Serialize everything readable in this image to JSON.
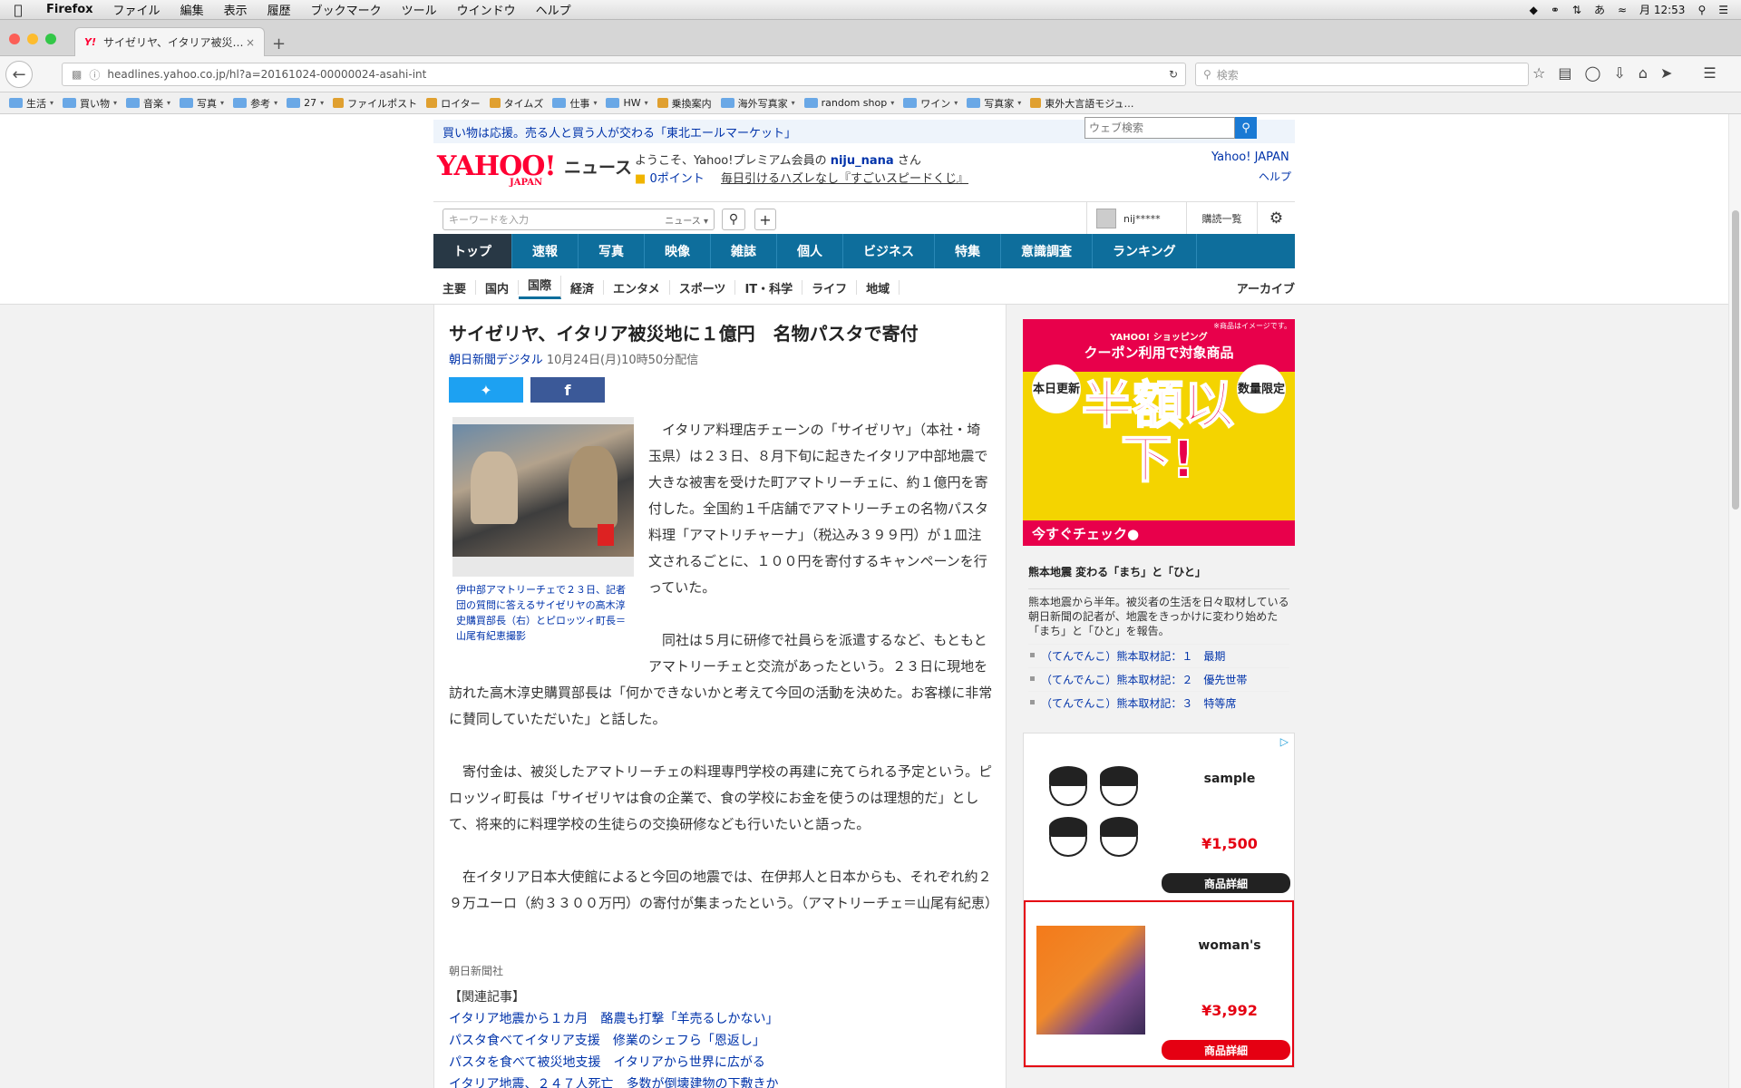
{
  "menubar": {
    "app": "Firefox",
    "items": [
      "ファイル",
      "編集",
      "表示",
      "履歴",
      "ブックマーク",
      "ツール",
      "ウインドウ",
      "ヘルプ"
    ],
    "clock": "月 12:53"
  },
  "tab": {
    "favicon": "Y!",
    "title": "サイゼリヤ、イタリア被災…",
    "close": "×",
    "new_tab": "+"
  },
  "navbar": {
    "url": "headlines.yahoo.co.jp/hl?a=20161024-00000024-asahi-int",
    "search_placeholder": "検索"
  },
  "bookmarks": [
    {
      "label": "生活",
      "folder": true
    },
    {
      "label": "買い物",
      "folder": true
    },
    {
      "label": "音楽",
      "folder": true
    },
    {
      "label": "写真",
      "folder": true
    },
    {
      "label": "参考",
      "folder": true
    },
    {
      "label": "27",
      "folder": true
    },
    {
      "label": "ファイルポスト",
      "folder": false
    },
    {
      "label": "ロイター",
      "folder": false
    },
    {
      "label": "タイムズ",
      "folder": false
    },
    {
      "label": "仕事",
      "folder": true
    },
    {
      "label": "HW",
      "folder": true
    },
    {
      "label": "乗換案内",
      "folder": false
    },
    {
      "label": "海外写真家",
      "folder": true
    },
    {
      "label": "random shop",
      "folder": true
    },
    {
      "label": "ワイン",
      "folder": true
    },
    {
      "label": "写真家",
      "folder": true
    },
    {
      "label": "東外大言語モジュ…",
      "folder": false
    }
  ],
  "header": {
    "promo": "買い物は応援。売る人と買う人が交わる「東北エールマーケット」",
    "web_search_placeholder": "ウェブ検索",
    "logo": "YAHOO!",
    "logo_sub": "JAPAN",
    "logo_news": "ニュース",
    "welcome_prefix": "ようこそ、Yahoo!プレミアム会員の",
    "welcome_user": "niju_nana",
    "welcome_suffix": "さん",
    "points": "0ポイント",
    "kuji": "毎日引けるハズレなし『すごいスピードくじ』",
    "yj_link": "Yahoo! JAPAN",
    "help_link": "ヘルプ",
    "keyword_placeholder": "キーワードを入力",
    "keyword_scope": "ニュース",
    "user_short": "nij*****",
    "subscriptions": "購読一覧"
  },
  "main_nav": [
    "トップ",
    "速報",
    "写真",
    "映像",
    "雑誌",
    "個人",
    "ビジネス",
    "特集",
    "意識調査",
    "ランキング"
  ],
  "sub_nav": [
    "主要",
    "国内",
    "国際",
    "経済",
    "エンタメ",
    "スポーツ",
    "IT・科学",
    "ライフ",
    "地域"
  ],
  "archive": "アーカイブ",
  "article": {
    "title": "サイゼリヤ、イタリア被災地に１億円　名物パスタで寄付",
    "source": "朝日新聞デジタル",
    "date": "10月24日(月)10時50分配信",
    "caption": "伊中部アマトリーチェで２３日、記者団の質問に答えるサイゼリヤの高木淳史購買部長（右）とピロッツィ町長＝山尾有紀恵撮影",
    "paragraphs": [
      "イタリア料理店チェーンの「サイゼリヤ」（本社・埼玉県）は２３日、８月下旬に起きたイタリア中部地震で大きな被害を受けた町アマトリーチェに、約１億円を寄付した。全国約１千店舗でアマトリーチェの名物パスタ料理「アマトリチャーナ」（税込み３９９円）が１皿注文されるごとに、１００円を寄付するキャンペーンを行っていた。",
      "同社は５月に研修で社員らを派遣するなど、もともとアマトリーチェと交流があったという。２３日に現地を訪れた高木淳史購買部長は「何かできないかと考えて今回の活動を決めた。お客様に非常に賛同していただいた」と話した。",
      "寄付金は、被災したアマトリーチェの料理専門学校の再建に充てられる予定という。ピロッツィ町長は「サイゼリヤは食の企業で、食の学校にお金を使うのは理想的だ」として、将来的に料理学校の生徒らの交換研修なども行いたいと語った。",
      "在イタリア日本大使館によると今回の地震では、在伊邦人と日本からも、それぞれ約２９万ユーロ（約３３００万円）の寄付が集まったという。（アマトリーチェ＝山尾有紀恵）"
    ],
    "credit": "朝日新聞社",
    "related_header": "【関連記事】",
    "related": [
      "イタリア地震から１カ月　酪農も打撃「羊売るしかない」",
      "パスタ食べてイタリア支援　修業のシェフら「恩返し」",
      "パスタを食べて被災地支援　イタリアから世界に広がる",
      "イタリア地震、２４７人死亡　多数が倒壊建物の下敷きか"
    ]
  },
  "sidebar": {
    "ad": {
      "brand": "YAHOO! ショッピング",
      "headline": "クーポン利用で対象商品",
      "left_badge": "本日更新",
      "right_badge": "数量限定",
      "big": "半額以下!",
      "cta": "今すぐチェック●",
      "note": "※商品はイメージです。"
    },
    "feature": {
      "title": "熊本地震 変わる「まち」と「ひと」",
      "description": "熊本地震から半年。被災者の生活を日々取材している朝日新聞の記者が、地震をきっかけに変わり始めた「まち」と「ひと」を報告。",
      "links": [
        "（てんでんこ）熊本取材記：１　最期",
        "（てんでんこ）熊本取材記：２　優先世帯",
        "（てんでんこ）熊本取材記：３　特等席"
      ]
    },
    "products": [
      {
        "name": "sample",
        "price": "¥1,500",
        "button": "商品詳細"
      },
      {
        "name": "woman's",
        "price": "¥3,992",
        "button": "商品詳細"
      }
    ]
  }
}
